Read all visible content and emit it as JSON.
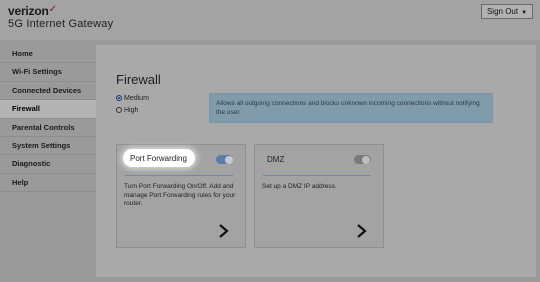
{
  "header": {
    "brand": "verizon",
    "brand_mark": "✓",
    "app_title": "5G Internet Gateway",
    "signout_label": "Sign Out"
  },
  "sidebar": {
    "items": [
      {
        "label": "Home"
      },
      {
        "label": "Wi-Fi Settings"
      },
      {
        "label": "Connected Devices"
      },
      {
        "label": "Firewall",
        "active": true
      },
      {
        "label": "Parental Controls"
      },
      {
        "label": "System Settings"
      },
      {
        "label": "Diagnostic"
      },
      {
        "label": "Help"
      }
    ]
  },
  "main": {
    "title": "Firewall",
    "security_levels": [
      {
        "label": "Medium",
        "selected": true
      },
      {
        "label": "High",
        "selected": false
      }
    ],
    "info_text": "Allows all outgoing connections and blocks unknown incoming connections without notifying the user.",
    "cards": [
      {
        "title": "Port Forwarding",
        "enabled": true,
        "description": "Turn Port Forwarding On/Off. Add and manage Port Forwarding rules for your router."
      },
      {
        "title": "DMZ",
        "enabled": false,
        "description": "Set up a DMZ IP address."
      }
    ]
  },
  "colors": {
    "accent": "#5b7fa6",
    "brand_check": "#8a1010",
    "info_bg": "#809bab"
  }
}
